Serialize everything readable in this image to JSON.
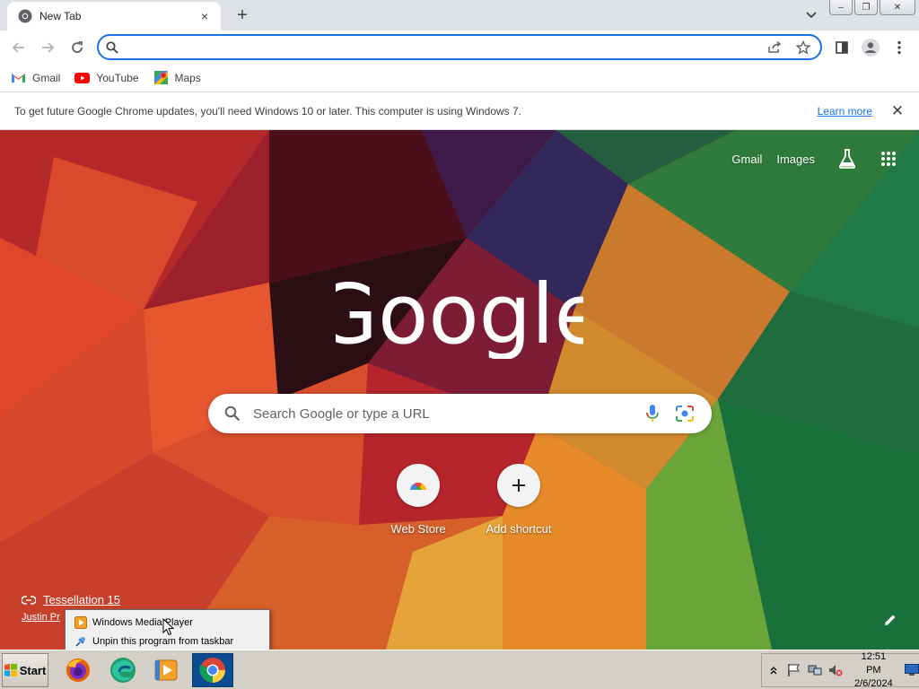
{
  "tab": {
    "title": "New Tab",
    "close": "×"
  },
  "new_tab": "+",
  "window": {
    "minimize": "–",
    "restore": "❐",
    "close": "✕"
  },
  "omnibox": {
    "value": "",
    "placeholder": ""
  },
  "bookmarks": [
    {
      "label": "Gmail",
      "icon": "gmail-icon"
    },
    {
      "label": "YouTube",
      "icon": "youtube-icon"
    },
    {
      "label": "Maps",
      "icon": "maps-icon"
    }
  ],
  "infobar": {
    "message": "To get future Google Chrome updates, you'll need Windows 10 or later. This computer is using Windows 7.",
    "link": "Learn more",
    "close": "✕"
  },
  "ntp": {
    "top_links": {
      "gmail": "Gmail",
      "images": "Images"
    },
    "logo_text": "Google",
    "search_placeholder": "Search Google or type a URL",
    "shortcuts": [
      {
        "label": "Web Store",
        "icon": "webstore-icon"
      },
      {
        "label": "Add shortcut",
        "icon": "plus-icon"
      }
    ],
    "attribution": {
      "title": "Tessellation 15",
      "author": "Justin Pr"
    }
  },
  "jumplist": [
    {
      "label": "Windows Media Player",
      "icon": "wmp-icon"
    },
    {
      "label": "Unpin this program from taskbar",
      "icon": "unpin-icon"
    }
  ],
  "taskbar": {
    "start": "Start",
    "apps": [
      "firefox-icon",
      "edge-icon",
      "wmp-icon",
      "chrome-icon"
    ],
    "clock": {
      "time": "12:51 PM",
      "date": "2/6/2024"
    }
  },
  "colors": {
    "accent": "#1a73e8",
    "taskbar": "#d4d0c8",
    "tabstrip": "#dee1e6"
  }
}
